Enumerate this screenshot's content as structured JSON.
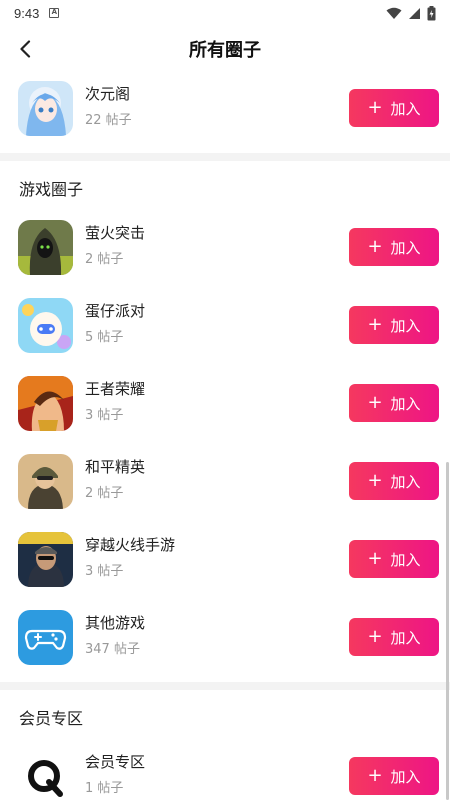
{
  "status_bar": {
    "time": "9:43",
    "notif_badge": "A"
  },
  "header": {
    "title": "所有圈子"
  },
  "top_item": {
    "name": "次元阁",
    "count": "22 帖子",
    "join_label": "加入"
  },
  "game_section": {
    "title": "游戏圈子",
    "items": [
      {
        "name": "萤火突击",
        "count": "2 帖子",
        "join_label": "加入"
      },
      {
        "name": "蛋仔派对",
        "count": "5 帖子",
        "join_label": "加入"
      },
      {
        "name": "王者荣耀",
        "count": "3 帖子",
        "join_label": "加入"
      },
      {
        "name": "和平精英",
        "count": "2 帖子",
        "join_label": "加入"
      },
      {
        "name": "穿越火线手游",
        "count": "3 帖子",
        "join_label": "加入"
      },
      {
        "name": "其他游戏",
        "count": "347 帖子",
        "join_label": "加入"
      }
    ]
  },
  "member_section": {
    "title": "会员专区",
    "items": [
      {
        "name": "会员专区",
        "count": "1 帖子",
        "join_label": "加入"
      }
    ]
  },
  "colors": {
    "accent_start": "#f5385f",
    "accent_end": "#ee1585",
    "other_games_icon_bg": "#2d9be0"
  }
}
